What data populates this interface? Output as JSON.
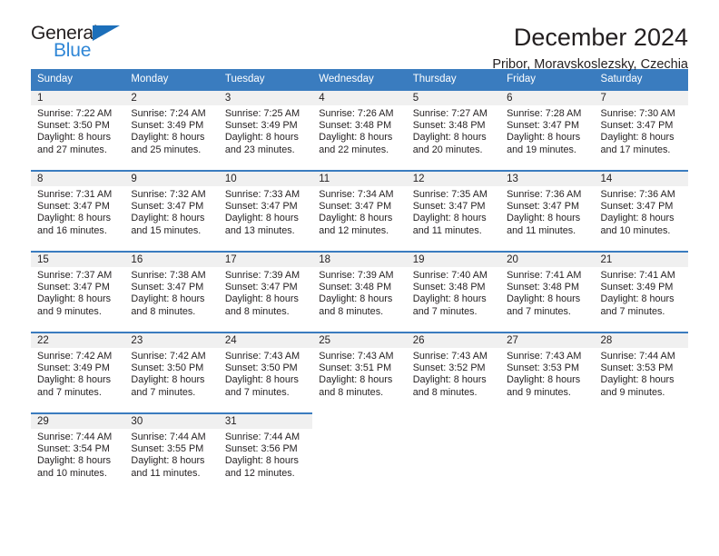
{
  "brand": {
    "name_part1": "General",
    "name_part2": "Blue",
    "triangle_color": "#1c6fba",
    "blue_color": "#2f86d6"
  },
  "header": {
    "title": "December 2024",
    "subtitle": "Pribor, Moravskoslezsky, Czechia"
  },
  "theme": {
    "header_blue": "#3a7cbf",
    "daynum_band": "#f0f0f0",
    "text": "#231f20"
  },
  "calendar": {
    "weekday_headers": [
      "Sunday",
      "Monday",
      "Tuesday",
      "Wednesday",
      "Thursday",
      "Friday",
      "Saturday"
    ],
    "weeks": [
      [
        {
          "day": "1",
          "sunrise": "Sunrise: 7:22 AM",
          "sunset": "Sunset: 3:50 PM",
          "daylight1": "Daylight: 8 hours",
          "daylight2": "and 27 minutes."
        },
        {
          "day": "2",
          "sunrise": "Sunrise: 7:24 AM",
          "sunset": "Sunset: 3:49 PM",
          "daylight1": "Daylight: 8 hours",
          "daylight2": "and 25 minutes."
        },
        {
          "day": "3",
          "sunrise": "Sunrise: 7:25 AM",
          "sunset": "Sunset: 3:49 PM",
          "daylight1": "Daylight: 8 hours",
          "daylight2": "and 23 minutes."
        },
        {
          "day": "4",
          "sunrise": "Sunrise: 7:26 AM",
          "sunset": "Sunset: 3:48 PM",
          "daylight1": "Daylight: 8 hours",
          "daylight2": "and 22 minutes."
        },
        {
          "day": "5",
          "sunrise": "Sunrise: 7:27 AM",
          "sunset": "Sunset: 3:48 PM",
          "daylight1": "Daylight: 8 hours",
          "daylight2": "and 20 minutes."
        },
        {
          "day": "6",
          "sunrise": "Sunrise: 7:28 AM",
          "sunset": "Sunset: 3:47 PM",
          "daylight1": "Daylight: 8 hours",
          "daylight2": "and 19 minutes."
        },
        {
          "day": "7",
          "sunrise": "Sunrise: 7:30 AM",
          "sunset": "Sunset: 3:47 PM",
          "daylight1": "Daylight: 8 hours",
          "daylight2": "and 17 minutes."
        }
      ],
      [
        {
          "day": "8",
          "sunrise": "Sunrise: 7:31 AM",
          "sunset": "Sunset: 3:47 PM",
          "daylight1": "Daylight: 8 hours",
          "daylight2": "and 16 minutes."
        },
        {
          "day": "9",
          "sunrise": "Sunrise: 7:32 AM",
          "sunset": "Sunset: 3:47 PM",
          "daylight1": "Daylight: 8 hours",
          "daylight2": "and 15 minutes."
        },
        {
          "day": "10",
          "sunrise": "Sunrise: 7:33 AM",
          "sunset": "Sunset: 3:47 PM",
          "daylight1": "Daylight: 8 hours",
          "daylight2": "and 13 minutes."
        },
        {
          "day": "11",
          "sunrise": "Sunrise: 7:34 AM",
          "sunset": "Sunset: 3:47 PM",
          "daylight1": "Daylight: 8 hours",
          "daylight2": "and 12 minutes."
        },
        {
          "day": "12",
          "sunrise": "Sunrise: 7:35 AM",
          "sunset": "Sunset: 3:47 PM",
          "daylight1": "Daylight: 8 hours",
          "daylight2": "and 11 minutes."
        },
        {
          "day": "13",
          "sunrise": "Sunrise: 7:36 AM",
          "sunset": "Sunset: 3:47 PM",
          "daylight1": "Daylight: 8 hours",
          "daylight2": "and 11 minutes."
        },
        {
          "day": "14",
          "sunrise": "Sunrise: 7:36 AM",
          "sunset": "Sunset: 3:47 PM",
          "daylight1": "Daylight: 8 hours",
          "daylight2": "and 10 minutes."
        }
      ],
      [
        {
          "day": "15",
          "sunrise": "Sunrise: 7:37 AM",
          "sunset": "Sunset: 3:47 PM",
          "daylight1": "Daylight: 8 hours",
          "daylight2": "and 9 minutes."
        },
        {
          "day": "16",
          "sunrise": "Sunrise: 7:38 AM",
          "sunset": "Sunset: 3:47 PM",
          "daylight1": "Daylight: 8 hours",
          "daylight2": "and 8 minutes."
        },
        {
          "day": "17",
          "sunrise": "Sunrise: 7:39 AM",
          "sunset": "Sunset: 3:47 PM",
          "daylight1": "Daylight: 8 hours",
          "daylight2": "and 8 minutes."
        },
        {
          "day": "18",
          "sunrise": "Sunrise: 7:39 AM",
          "sunset": "Sunset: 3:48 PM",
          "daylight1": "Daylight: 8 hours",
          "daylight2": "and 8 minutes."
        },
        {
          "day": "19",
          "sunrise": "Sunrise: 7:40 AM",
          "sunset": "Sunset: 3:48 PM",
          "daylight1": "Daylight: 8 hours",
          "daylight2": "and 7 minutes."
        },
        {
          "day": "20",
          "sunrise": "Sunrise: 7:41 AM",
          "sunset": "Sunset: 3:48 PM",
          "daylight1": "Daylight: 8 hours",
          "daylight2": "and 7 minutes."
        },
        {
          "day": "21",
          "sunrise": "Sunrise: 7:41 AM",
          "sunset": "Sunset: 3:49 PM",
          "daylight1": "Daylight: 8 hours",
          "daylight2": "and 7 minutes."
        }
      ],
      [
        {
          "day": "22",
          "sunrise": "Sunrise: 7:42 AM",
          "sunset": "Sunset: 3:49 PM",
          "daylight1": "Daylight: 8 hours",
          "daylight2": "and 7 minutes."
        },
        {
          "day": "23",
          "sunrise": "Sunrise: 7:42 AM",
          "sunset": "Sunset: 3:50 PM",
          "daylight1": "Daylight: 8 hours",
          "daylight2": "and 7 minutes."
        },
        {
          "day": "24",
          "sunrise": "Sunrise: 7:43 AM",
          "sunset": "Sunset: 3:50 PM",
          "daylight1": "Daylight: 8 hours",
          "daylight2": "and 7 minutes."
        },
        {
          "day": "25",
          "sunrise": "Sunrise: 7:43 AM",
          "sunset": "Sunset: 3:51 PM",
          "daylight1": "Daylight: 8 hours",
          "daylight2": "and 8 minutes."
        },
        {
          "day": "26",
          "sunrise": "Sunrise: 7:43 AM",
          "sunset": "Sunset: 3:52 PM",
          "daylight1": "Daylight: 8 hours",
          "daylight2": "and 8 minutes."
        },
        {
          "day": "27",
          "sunrise": "Sunrise: 7:43 AM",
          "sunset": "Sunset: 3:53 PM",
          "daylight1": "Daylight: 8 hours",
          "daylight2": "and 9 minutes."
        },
        {
          "day": "28",
          "sunrise": "Sunrise: 7:44 AM",
          "sunset": "Sunset: 3:53 PM",
          "daylight1": "Daylight: 8 hours",
          "daylight2": "and 9 minutes."
        }
      ],
      [
        {
          "day": "29",
          "sunrise": "Sunrise: 7:44 AM",
          "sunset": "Sunset: 3:54 PM",
          "daylight1": "Daylight: 8 hours",
          "daylight2": "and 10 minutes."
        },
        {
          "day": "30",
          "sunrise": "Sunrise: 7:44 AM",
          "sunset": "Sunset: 3:55 PM",
          "daylight1": "Daylight: 8 hours",
          "daylight2": "and 11 minutes."
        },
        {
          "day": "31",
          "sunrise": "Sunrise: 7:44 AM",
          "sunset": "Sunset: 3:56 PM",
          "daylight1": "Daylight: 8 hours",
          "daylight2": "and 12 minutes."
        },
        {
          "day": "",
          "sunrise": "",
          "sunset": "",
          "daylight1": "",
          "daylight2": ""
        },
        {
          "day": "",
          "sunrise": "",
          "sunset": "",
          "daylight1": "",
          "daylight2": ""
        },
        {
          "day": "",
          "sunrise": "",
          "sunset": "",
          "daylight1": "",
          "daylight2": ""
        },
        {
          "day": "",
          "sunrise": "",
          "sunset": "",
          "daylight1": "",
          "daylight2": ""
        }
      ]
    ]
  }
}
